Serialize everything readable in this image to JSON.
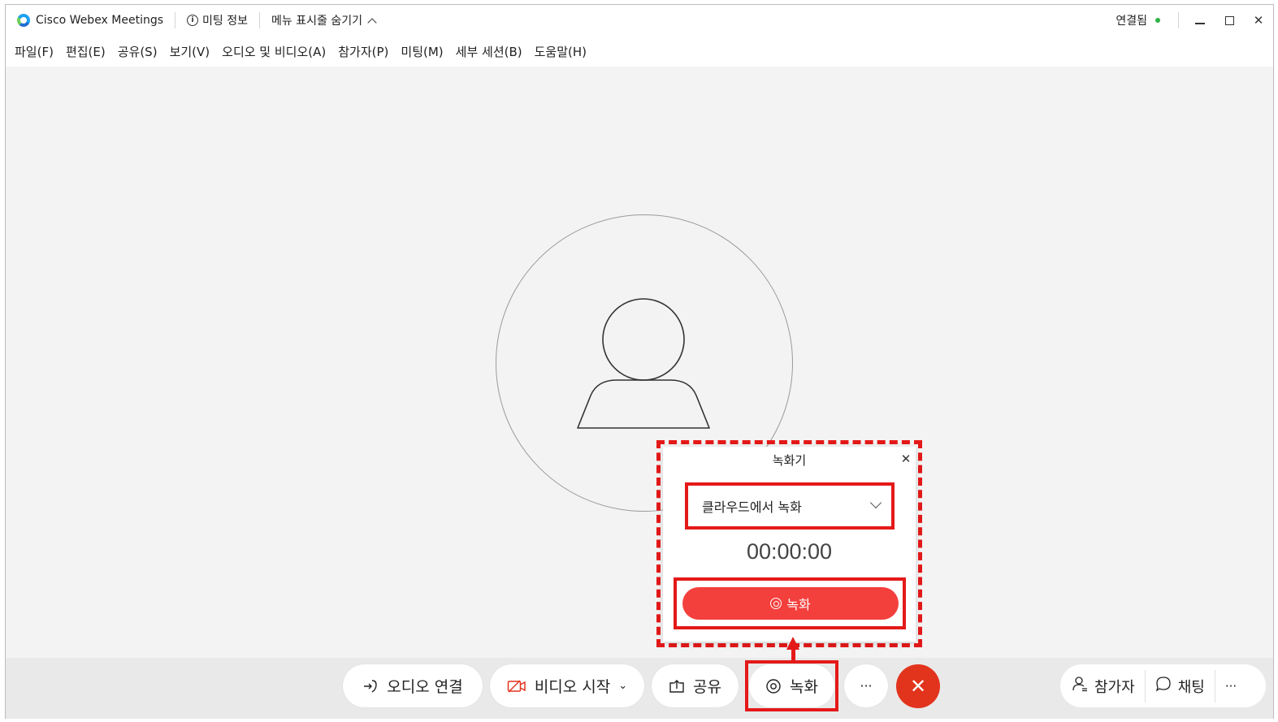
{
  "titlebar": {
    "app_title": "Cisco Webex Meetings",
    "meeting_info": "미팅 정보",
    "hide_menu": "메뉴 표시줄 숨기기",
    "status": "연결됨",
    "status_color": "#2fb344"
  },
  "menubar": {
    "items": [
      "파일(F)",
      "편집(E)",
      "공유(S)",
      "보기(V)",
      "오디오 및 비디오(A)",
      "참가자(P)",
      "미팅(M)",
      "세부 세션(B)",
      "도움말(H)"
    ]
  },
  "recorder": {
    "title": "녹화기",
    "mode": "클라우드에서 녹화",
    "timer": "00:00:00",
    "record_label": "녹화",
    "accent": "#f3403d"
  },
  "controls": {
    "audio": "오디오 연결",
    "video": "비디오 시작",
    "share": "공유",
    "record": "녹화",
    "more": "···",
    "participants": "참가자",
    "chat": "채팅",
    "more_right": "···"
  },
  "highlight_color": "#e41919"
}
